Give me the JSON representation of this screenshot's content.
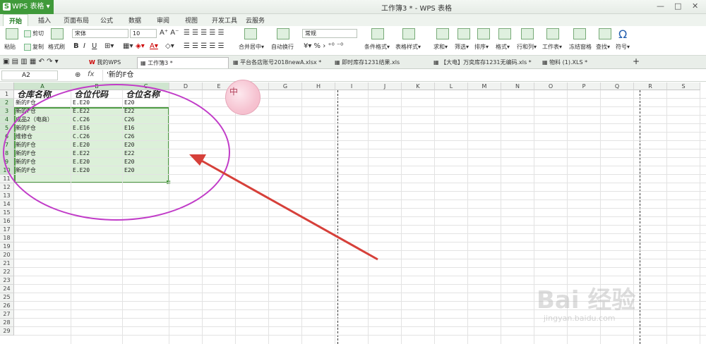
{
  "app": {
    "name": "WPS 表格",
    "window_title": "工作簿3 * - WPS 表格"
  },
  "ribbon_tabs": [
    "开始",
    "插入",
    "页面布局",
    "公式",
    "数据",
    "审阅",
    "视图",
    "开发工具",
    "云服务"
  ],
  "ribbon": {
    "paste": "粘贴",
    "cut": "剪切",
    "copy": "复制",
    "format_painter": "格式刷",
    "font_name": "宋体",
    "font_size": "10",
    "merge": "合并居中",
    "wrap": "自动换行",
    "number_format": "常规",
    "cond_format": "条件格式",
    "table_style": "表格样式",
    "sum": "求和",
    "filter": "筛选",
    "sort": "排序",
    "format": "格式",
    "rowcol": "行和列",
    "sheet": "工作表",
    "freeze": "冻结窗格",
    "find": "查找",
    "symbol": "符号"
  },
  "doc_tabs": [
    {
      "label": "我的WPS"
    },
    {
      "label": "工作簿3 *"
    },
    {
      "label": "平台各店账号2018newA.xlsx *"
    },
    {
      "label": "即时库存1231结果.xls"
    },
    {
      "label": "【大电】万奕库存1231无编码.xls *"
    },
    {
      "label": "物料 (1).XLS *"
    }
  ],
  "formula_bar": {
    "name_box": "A2",
    "fx": "fx",
    "content": "'新的F仓"
  },
  "columns": [
    "A",
    "B",
    "C",
    "D",
    "E",
    "F",
    "G",
    "H",
    "I",
    "J",
    "K",
    "L",
    "M",
    "N",
    "O",
    "P",
    "Q",
    "R",
    "S"
  ],
  "rows": [
    "1",
    "2",
    "3",
    "4",
    "5",
    "6",
    "7",
    "8",
    "9",
    "10",
    "11",
    "12",
    "13",
    "14",
    "15",
    "16",
    "17",
    "18",
    "19",
    "20",
    "21",
    "22",
    "23",
    "24",
    "25",
    "26",
    "27",
    "28",
    "29"
  ],
  "table": {
    "headers": [
      "仓库名称",
      "仓位代码",
      "仓位名称"
    ],
    "rows": [
      [
        "新的F仓",
        "E.E20",
        "E20"
      ],
      [
        "新的F仓",
        "E.E22",
        "E22"
      ],
      [
        "成品2（电商）",
        "C.C26",
        "C26"
      ],
      [
        "新的F仓",
        "E.E16",
        "E16"
      ],
      [
        "维修仓",
        "C.C26",
        "C26"
      ],
      [
        "新的F仓",
        "E.E20",
        "E20"
      ],
      [
        "新的F仓",
        "E.E22",
        "E22"
      ],
      [
        "新的F仓",
        "E.E20",
        "E20"
      ],
      [
        "新的F仓",
        "E.E20",
        "E20"
      ]
    ]
  },
  "stamp_char": "中",
  "watermark": "Bai 经验",
  "watermark_sub": "jingyan.baidu.com"
}
